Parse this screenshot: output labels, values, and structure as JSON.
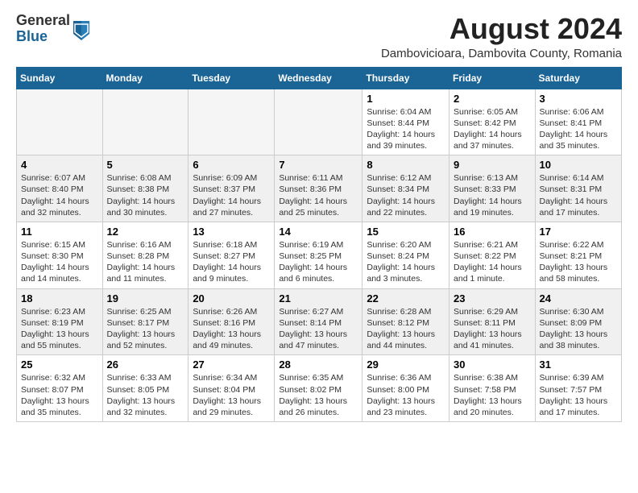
{
  "header": {
    "logo_line1": "General",
    "logo_line2": "Blue",
    "main_title": "August 2024",
    "subtitle": "Dambovicioara, Dambovita County, Romania"
  },
  "weekdays": [
    "Sunday",
    "Monday",
    "Tuesday",
    "Wednesday",
    "Thursday",
    "Friday",
    "Saturday"
  ],
  "weeks": [
    [
      {
        "day": "",
        "info": ""
      },
      {
        "day": "",
        "info": ""
      },
      {
        "day": "",
        "info": ""
      },
      {
        "day": "",
        "info": ""
      },
      {
        "day": "1",
        "info": "Sunrise: 6:04 AM\nSunset: 8:44 PM\nDaylight: 14 hours\nand 39 minutes."
      },
      {
        "day": "2",
        "info": "Sunrise: 6:05 AM\nSunset: 8:42 PM\nDaylight: 14 hours\nand 37 minutes."
      },
      {
        "day": "3",
        "info": "Sunrise: 6:06 AM\nSunset: 8:41 PM\nDaylight: 14 hours\nand 35 minutes."
      }
    ],
    [
      {
        "day": "4",
        "info": "Sunrise: 6:07 AM\nSunset: 8:40 PM\nDaylight: 14 hours\nand 32 minutes."
      },
      {
        "day": "5",
        "info": "Sunrise: 6:08 AM\nSunset: 8:38 PM\nDaylight: 14 hours\nand 30 minutes."
      },
      {
        "day": "6",
        "info": "Sunrise: 6:09 AM\nSunset: 8:37 PM\nDaylight: 14 hours\nand 27 minutes."
      },
      {
        "day": "7",
        "info": "Sunrise: 6:11 AM\nSunset: 8:36 PM\nDaylight: 14 hours\nand 25 minutes."
      },
      {
        "day": "8",
        "info": "Sunrise: 6:12 AM\nSunset: 8:34 PM\nDaylight: 14 hours\nand 22 minutes."
      },
      {
        "day": "9",
        "info": "Sunrise: 6:13 AM\nSunset: 8:33 PM\nDaylight: 14 hours\nand 19 minutes."
      },
      {
        "day": "10",
        "info": "Sunrise: 6:14 AM\nSunset: 8:31 PM\nDaylight: 14 hours\nand 17 minutes."
      }
    ],
    [
      {
        "day": "11",
        "info": "Sunrise: 6:15 AM\nSunset: 8:30 PM\nDaylight: 14 hours\nand 14 minutes."
      },
      {
        "day": "12",
        "info": "Sunrise: 6:16 AM\nSunset: 8:28 PM\nDaylight: 14 hours\nand 11 minutes."
      },
      {
        "day": "13",
        "info": "Sunrise: 6:18 AM\nSunset: 8:27 PM\nDaylight: 14 hours\nand 9 minutes."
      },
      {
        "day": "14",
        "info": "Sunrise: 6:19 AM\nSunset: 8:25 PM\nDaylight: 14 hours\nand 6 minutes."
      },
      {
        "day": "15",
        "info": "Sunrise: 6:20 AM\nSunset: 8:24 PM\nDaylight: 14 hours\nand 3 minutes."
      },
      {
        "day": "16",
        "info": "Sunrise: 6:21 AM\nSunset: 8:22 PM\nDaylight: 14 hours\nand 1 minute."
      },
      {
        "day": "17",
        "info": "Sunrise: 6:22 AM\nSunset: 8:21 PM\nDaylight: 13 hours\nand 58 minutes."
      }
    ],
    [
      {
        "day": "18",
        "info": "Sunrise: 6:23 AM\nSunset: 8:19 PM\nDaylight: 13 hours\nand 55 minutes."
      },
      {
        "day": "19",
        "info": "Sunrise: 6:25 AM\nSunset: 8:17 PM\nDaylight: 13 hours\nand 52 minutes."
      },
      {
        "day": "20",
        "info": "Sunrise: 6:26 AM\nSunset: 8:16 PM\nDaylight: 13 hours\nand 49 minutes."
      },
      {
        "day": "21",
        "info": "Sunrise: 6:27 AM\nSunset: 8:14 PM\nDaylight: 13 hours\nand 47 minutes."
      },
      {
        "day": "22",
        "info": "Sunrise: 6:28 AM\nSunset: 8:12 PM\nDaylight: 13 hours\nand 44 minutes."
      },
      {
        "day": "23",
        "info": "Sunrise: 6:29 AM\nSunset: 8:11 PM\nDaylight: 13 hours\nand 41 minutes."
      },
      {
        "day": "24",
        "info": "Sunrise: 6:30 AM\nSunset: 8:09 PM\nDaylight: 13 hours\nand 38 minutes."
      }
    ],
    [
      {
        "day": "25",
        "info": "Sunrise: 6:32 AM\nSunset: 8:07 PM\nDaylight: 13 hours\nand 35 minutes."
      },
      {
        "day": "26",
        "info": "Sunrise: 6:33 AM\nSunset: 8:05 PM\nDaylight: 13 hours\nand 32 minutes."
      },
      {
        "day": "27",
        "info": "Sunrise: 6:34 AM\nSunset: 8:04 PM\nDaylight: 13 hours\nand 29 minutes."
      },
      {
        "day": "28",
        "info": "Sunrise: 6:35 AM\nSunset: 8:02 PM\nDaylight: 13 hours\nand 26 minutes."
      },
      {
        "day": "29",
        "info": "Sunrise: 6:36 AM\nSunset: 8:00 PM\nDaylight: 13 hours\nand 23 minutes."
      },
      {
        "day": "30",
        "info": "Sunrise: 6:38 AM\nSunset: 7:58 PM\nDaylight: 13 hours\nand 20 minutes."
      },
      {
        "day": "31",
        "info": "Sunrise: 6:39 AM\nSunset: 7:57 PM\nDaylight: 13 hours\nand 17 minutes."
      }
    ]
  ]
}
